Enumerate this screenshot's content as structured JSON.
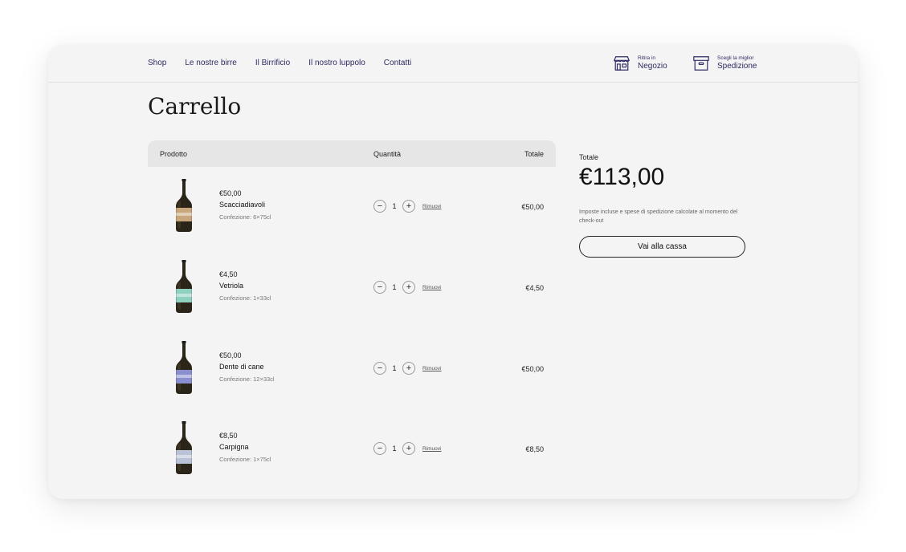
{
  "nav": {
    "items": [
      "Shop",
      "Le nostre birre",
      "Il Birrificio",
      "Il nostro luppolo",
      "Contatti"
    ]
  },
  "header_actions": {
    "store": {
      "small": "Ritira in",
      "big": "Negozio",
      "icon": "store-icon"
    },
    "shipping": {
      "small": "Scegli la miglior",
      "big": "Spedizione",
      "icon": "box-icon"
    }
  },
  "page": {
    "title": "Carrello"
  },
  "table": {
    "headers": {
      "product": "Prodotto",
      "quantity": "Quantità",
      "total": "Totale"
    },
    "remove_label": "Rimuovi",
    "items": [
      {
        "price": "€50,00",
        "name": "Scacciadiavoli",
        "pack": "Confezione: 6×75cl",
        "qty": "1",
        "total": "€50,00",
        "label_color": "#c9a77c"
      },
      {
        "price": "€4,50",
        "name": "Vetriola",
        "pack": "Confezione: 1×33cl",
        "qty": "1",
        "total": "€4,50",
        "label_color": "#8fd0c0"
      },
      {
        "price": "€50,00",
        "name": "Dente di cane",
        "pack": "Confezione: 12×33cl",
        "qty": "1",
        "total": "€50,00",
        "label_color": "#8a8fd0"
      },
      {
        "price": "€8,50",
        "name": "Carpigna",
        "pack": "Confezione: 1×75cl",
        "qty": "1",
        "total": "€8,50",
        "label_color": "#b9c2d6"
      }
    ]
  },
  "summary": {
    "label": "Totale",
    "total": "€113,00",
    "note": "Imposte incluse e spese di spedizione calcolate al momento del check-out",
    "checkout_label": "Vai alla cassa"
  },
  "colors": {
    "nav_text": "#2d2b63",
    "background": "#f4f4f4"
  }
}
